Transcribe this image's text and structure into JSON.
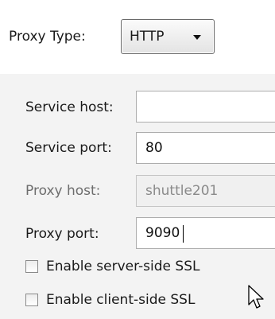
{
  "proxy_type": {
    "label": "Proxy Type:",
    "selected": "HTTP",
    "arrow_icon": "chevron-down-icon"
  },
  "fields": [
    {
      "label": "Service host:",
      "value": "",
      "enabled": true
    },
    {
      "label": "Service port:",
      "value": "80",
      "enabled": true
    },
    {
      "label": "Proxy host:",
      "value": "shuttle201",
      "enabled": false
    },
    {
      "label": "Proxy port:",
      "value": "9090",
      "enabled": true,
      "focused": true
    }
  ],
  "checkboxes": [
    {
      "label": "Enable server-side SSL",
      "checked": false
    },
    {
      "label": "Enable client-side SSL",
      "checked": false
    }
  ],
  "cursor_icon": "mouse-pointer-icon"
}
